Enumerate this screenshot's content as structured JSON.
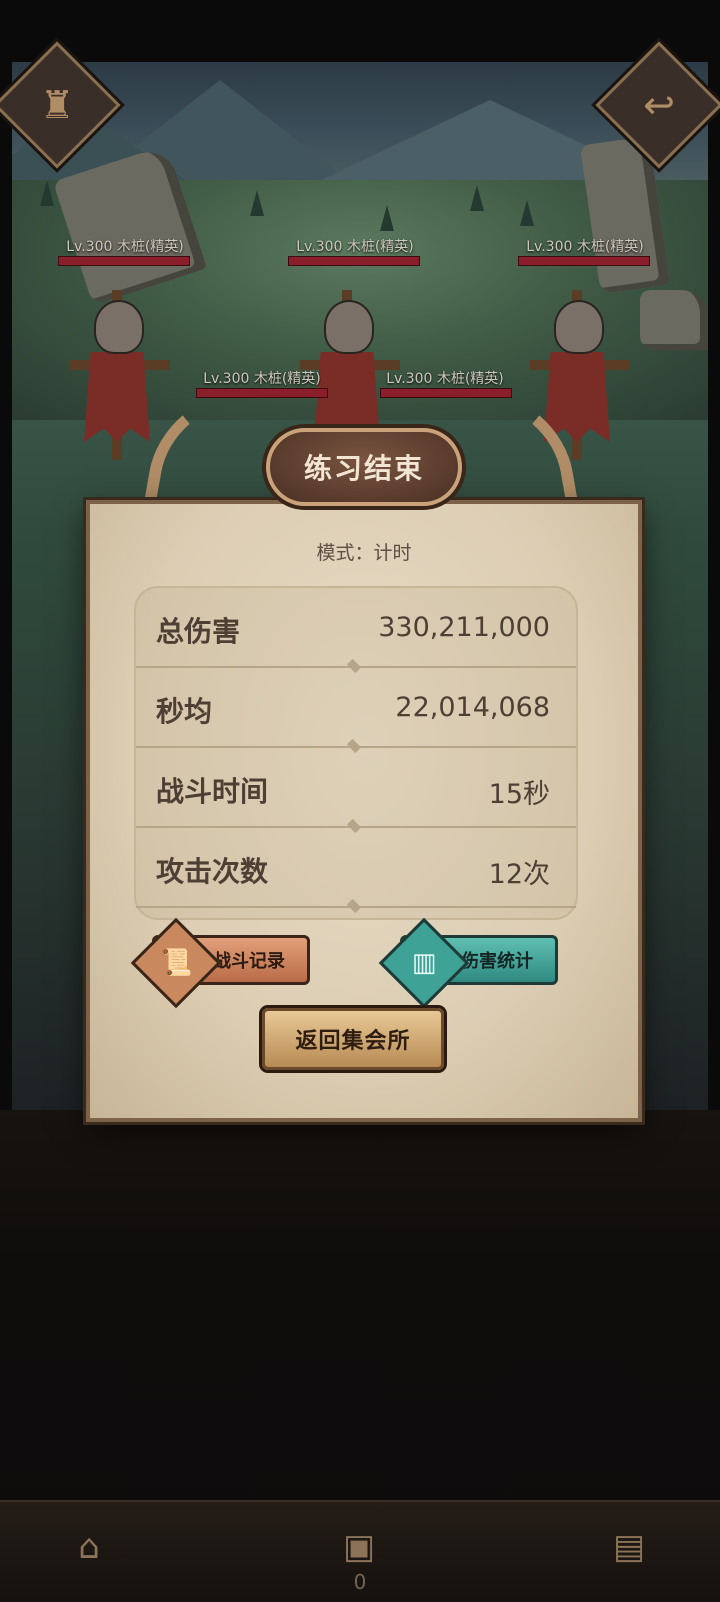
{
  "enemies": [
    {
      "label": "Lv.300  木桩(精英)"
    },
    {
      "label": "Lv.300  木桩(精英)"
    },
    {
      "label": "Lv.300  木桩(精英)"
    },
    {
      "label": "Lv.300  木桩(精英)"
    },
    {
      "label": "Lv.300  木桩(精英)"
    }
  ],
  "result": {
    "title": "练习结束",
    "mode": "模式：计时",
    "stats": [
      {
        "label": "总伤害",
        "value": "330,211,000"
      },
      {
        "label": "秒均",
        "value": "22,014,068"
      },
      {
        "label": "战斗时间",
        "value": "15秒"
      },
      {
        "label": "攻击次数",
        "value": "12次"
      }
    ],
    "battle_log_button": "战斗记录",
    "damage_stats_button": "伤害统计",
    "return_button": "返回集会所"
  },
  "bottom": {
    "count": "0"
  },
  "icons": {
    "top_left": "castle-icon",
    "top_right": "return-arrow-icon",
    "battle_log": "scroll-icon",
    "damage_stats": "bar-chart-icon"
  },
  "colors": {
    "parchment": "#dccdb3",
    "banner": "#4a3024",
    "log_button": "#c9885e",
    "stat_button": "#3ea296",
    "hp_bar": "#8a1f2b"
  }
}
